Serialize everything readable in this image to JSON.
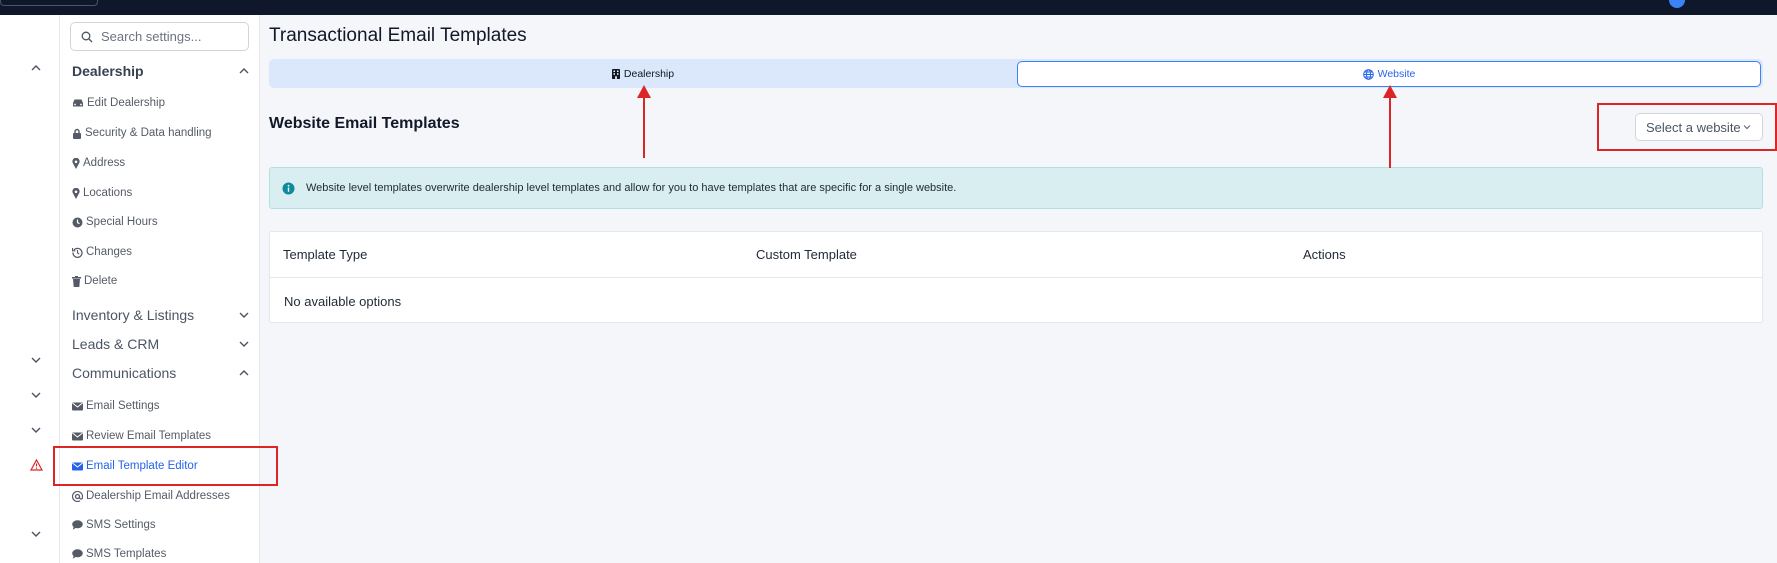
{
  "colors": {
    "accent": "#2563eb",
    "annotation": "#dc2626",
    "info_bg": "#d8eef0"
  },
  "sidebar": {
    "search_placeholder": "Search settings...",
    "sections": {
      "dealership": "Dealership",
      "inventory": "Inventory & Listings",
      "leads": "Leads & CRM",
      "communications": "Communications"
    },
    "dealership_items": [
      {
        "label": "Edit Dealership",
        "icon": "car-icon"
      },
      {
        "label": "Security & Data handling",
        "icon": "lock-icon"
      },
      {
        "label": "Address",
        "icon": "map-pin-icon"
      },
      {
        "label": "Locations",
        "icon": "map-pin-icon"
      },
      {
        "label": "Special Hours",
        "icon": "clock-icon"
      },
      {
        "label": "Changes",
        "icon": "history-icon"
      },
      {
        "label": "Delete",
        "icon": "trash-icon"
      }
    ],
    "communications_items": [
      {
        "label": "Email Settings",
        "icon": "envelope-icon"
      },
      {
        "label": "Review Email Templates",
        "icon": "envelope-icon"
      },
      {
        "label": "Email Template Editor",
        "icon": "envelope-icon",
        "active": true
      },
      {
        "label": "Dealership Email Addresses",
        "icon": "at-icon"
      },
      {
        "label": "SMS Settings",
        "icon": "chat-icon"
      },
      {
        "label": "SMS Templates",
        "icon": "chat-icon"
      }
    ]
  },
  "main": {
    "page_title": "Transactional Email Templates",
    "tabs": [
      {
        "label": "Dealership",
        "icon": "building-icon"
      },
      {
        "label": "Website",
        "icon": "globe-icon",
        "selected": true
      }
    ],
    "section_title": "Website Email Templates",
    "website_select": {
      "value": "Select a website"
    },
    "alert": "Website level templates overwrite dealership level templates and allow for you to have templates that are specific for a single website.",
    "table": {
      "columns": [
        "Template Type",
        "Custom Template",
        "Actions"
      ],
      "empty_text": "No available options"
    }
  }
}
